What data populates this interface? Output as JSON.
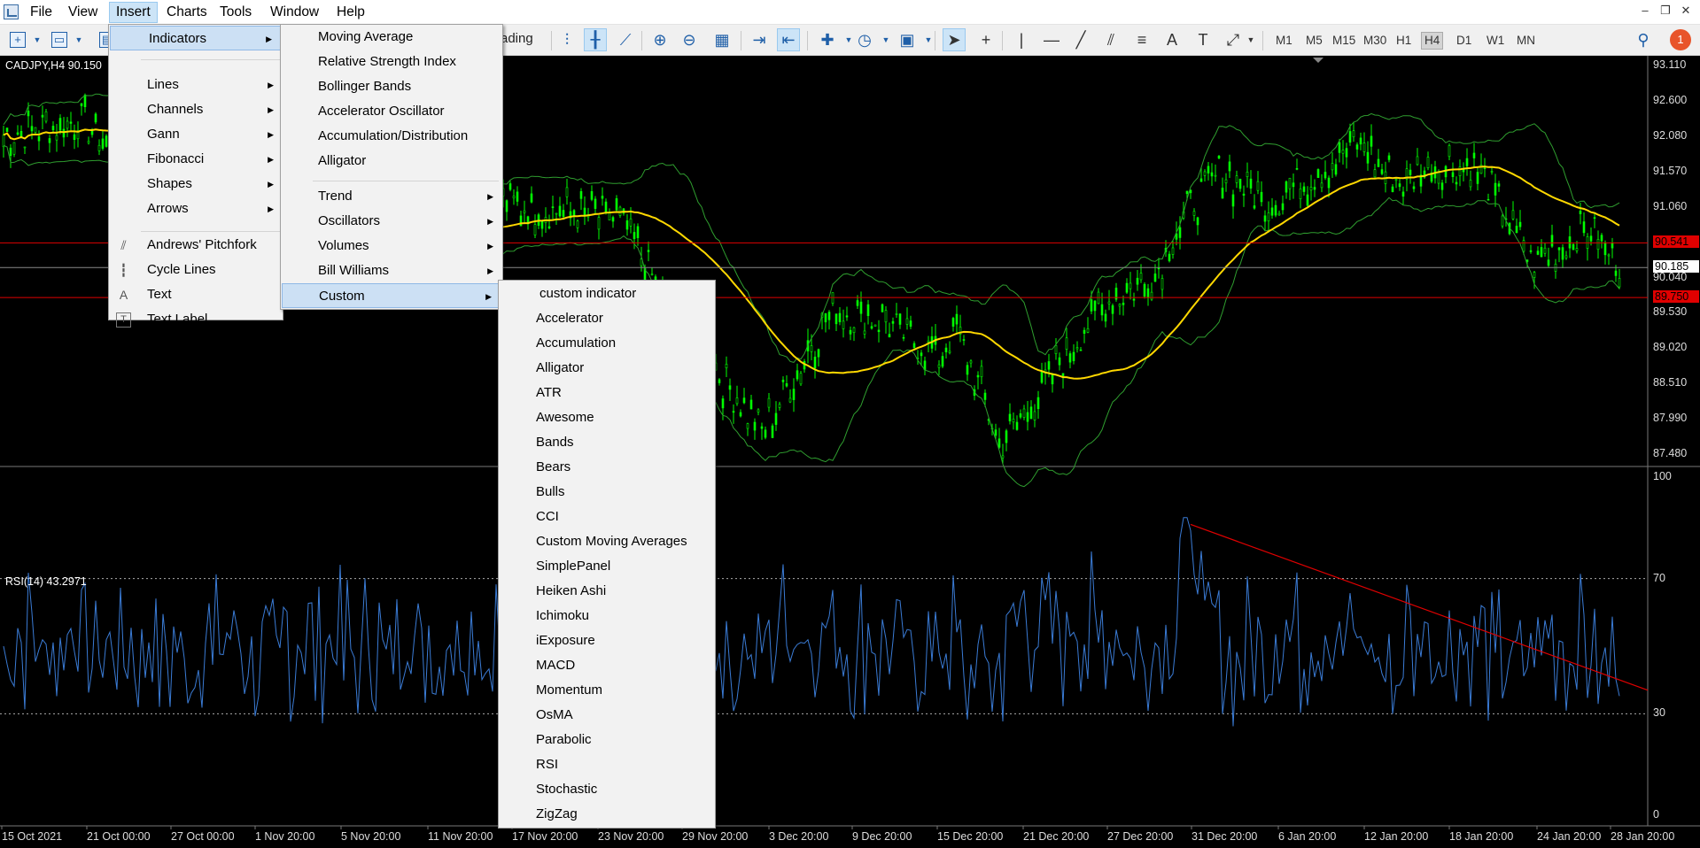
{
  "menubar": {
    "items": [
      "File",
      "View",
      "Insert",
      "Charts",
      "Tools",
      "Window",
      "Help"
    ],
    "active": "Insert"
  },
  "toolbar": {
    "trading_label": "rading",
    "timeframes": [
      "M1",
      "M5",
      "M15",
      "M30",
      "H1",
      "H4",
      "D1",
      "W1",
      "MN"
    ],
    "active_timeframe": "H4",
    "notification_count": "1"
  },
  "chart": {
    "symbol_label": "CADJPY,H4  90.150",
    "rsi_label": "RSI(14) 43.2971",
    "price_axis": [
      "93.110",
      "92.600",
      "92.080",
      "91.570",
      "91.060",
      "90.541",
      "90.185",
      "90.040",
      "89.750",
      "89.530",
      "89.020",
      "88.510",
      "87.990",
      "87.480"
    ],
    "tagged_prices": {
      "upper": "90.541",
      "current": "90.185",
      "lower": "89.750"
    },
    "rsi_axis": [
      "100",
      "70",
      "30",
      "0"
    ],
    "time_axis": [
      "15 Oct 2021",
      "21 Oct 00:00",
      "27 Oct 00:00",
      "1 Nov 20:00",
      "5 Nov 20:00",
      "11 Nov 20:00",
      "17 Nov 20:00",
      "23 Nov 20:00",
      "29 Nov 20:00",
      "3 Dec 20:00",
      "9 Dec 20:00",
      "15 Dec 20:00",
      "21 Dec 20:00",
      "27 Dec 20:00",
      "31 Dec 20:00",
      "6 Jan 20:00",
      "12 Jan 20:00",
      "18 Jan 20:00",
      "24 Jan 20:00",
      "28 Jan 20:00"
    ],
    "colors": {
      "candle": "#00ff00",
      "bands": "#2f9e2f",
      "ma": "#ffd800",
      "rsi": "#3a7bd5",
      "hline": "#e00000",
      "trend": "#e00000"
    }
  },
  "insert_menu": {
    "items": [
      {
        "label": "Indicators",
        "submenu": true,
        "highlighted": true
      },
      {
        "label": "Lines",
        "submenu": true
      },
      {
        "label": "Channels",
        "submenu": true
      },
      {
        "label": "Gann",
        "submenu": true
      },
      {
        "label": "Fibonacci",
        "submenu": true
      },
      {
        "label": "Shapes",
        "submenu": true
      },
      {
        "label": "Arrows",
        "submenu": true
      },
      {
        "label": "Andrews' Pitchfork",
        "icon": "pitchfork-icon"
      },
      {
        "label": "Cycle Lines",
        "icon": "cycle-lines-icon"
      },
      {
        "label": "Text",
        "icon": "text-icon"
      },
      {
        "label": "Text Label",
        "icon": "text-label-icon"
      }
    ]
  },
  "indicators_menu": {
    "items": [
      "Moving Average",
      "Relative Strength Index",
      "Bollinger Bands",
      "Accelerator Oscillator",
      "Accumulation/Distribution",
      "Alligator",
      "Trend",
      "Oscillators",
      "Volumes",
      "Bill Williams",
      "Custom"
    ],
    "highlighted": "Custom"
  },
  "custom_menu": {
    "items": [
      "custom indicator",
      "Accelerator",
      "Accumulation",
      "Alligator",
      "ATR",
      "Awesome",
      "Bands",
      "Bears",
      "Bulls",
      "CCI",
      "Custom Moving Averages",
      "SimplePanel",
      "Heiken Ashi",
      "Ichimoku",
      "iExposure",
      "MACD",
      "Momentum",
      "OsMA",
      "Parabolic",
      "RSI",
      "Stochastic",
      "ZigZag"
    ]
  }
}
